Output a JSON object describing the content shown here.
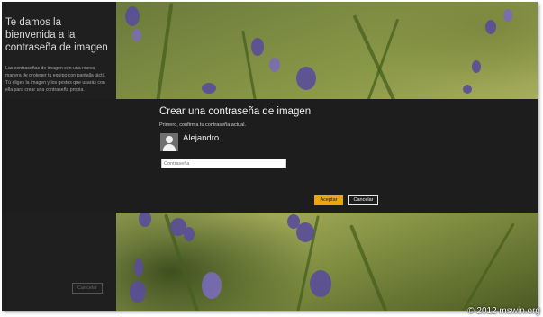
{
  "left_panel": {
    "title": "Te damos la bienvenida a la contraseña de imagen",
    "description": "Las contraseñas de imagen son una nueva manera de proteger tu equipo con pantalla táctil. Tú eliges la imagen y los gestos que usarás con ella para crear una contraseña propia.",
    "cancel_label": "Cancelar"
  },
  "dialog": {
    "title": "Crear una contraseña de imagen",
    "subtitle": "Primero, confirma tu contraseña actual.",
    "user_name": "Alejandro",
    "password_placeholder": "Contraseña",
    "password_value": "",
    "accept_label": "Aceptar",
    "cancel_label": "Cancelar"
  },
  "watermark": "© 2012 mswin.org",
  "colors": {
    "accent": "#f0a30a",
    "dialog_bg": "#1d1d1d",
    "left_panel_bg": "#1f1f1f"
  }
}
